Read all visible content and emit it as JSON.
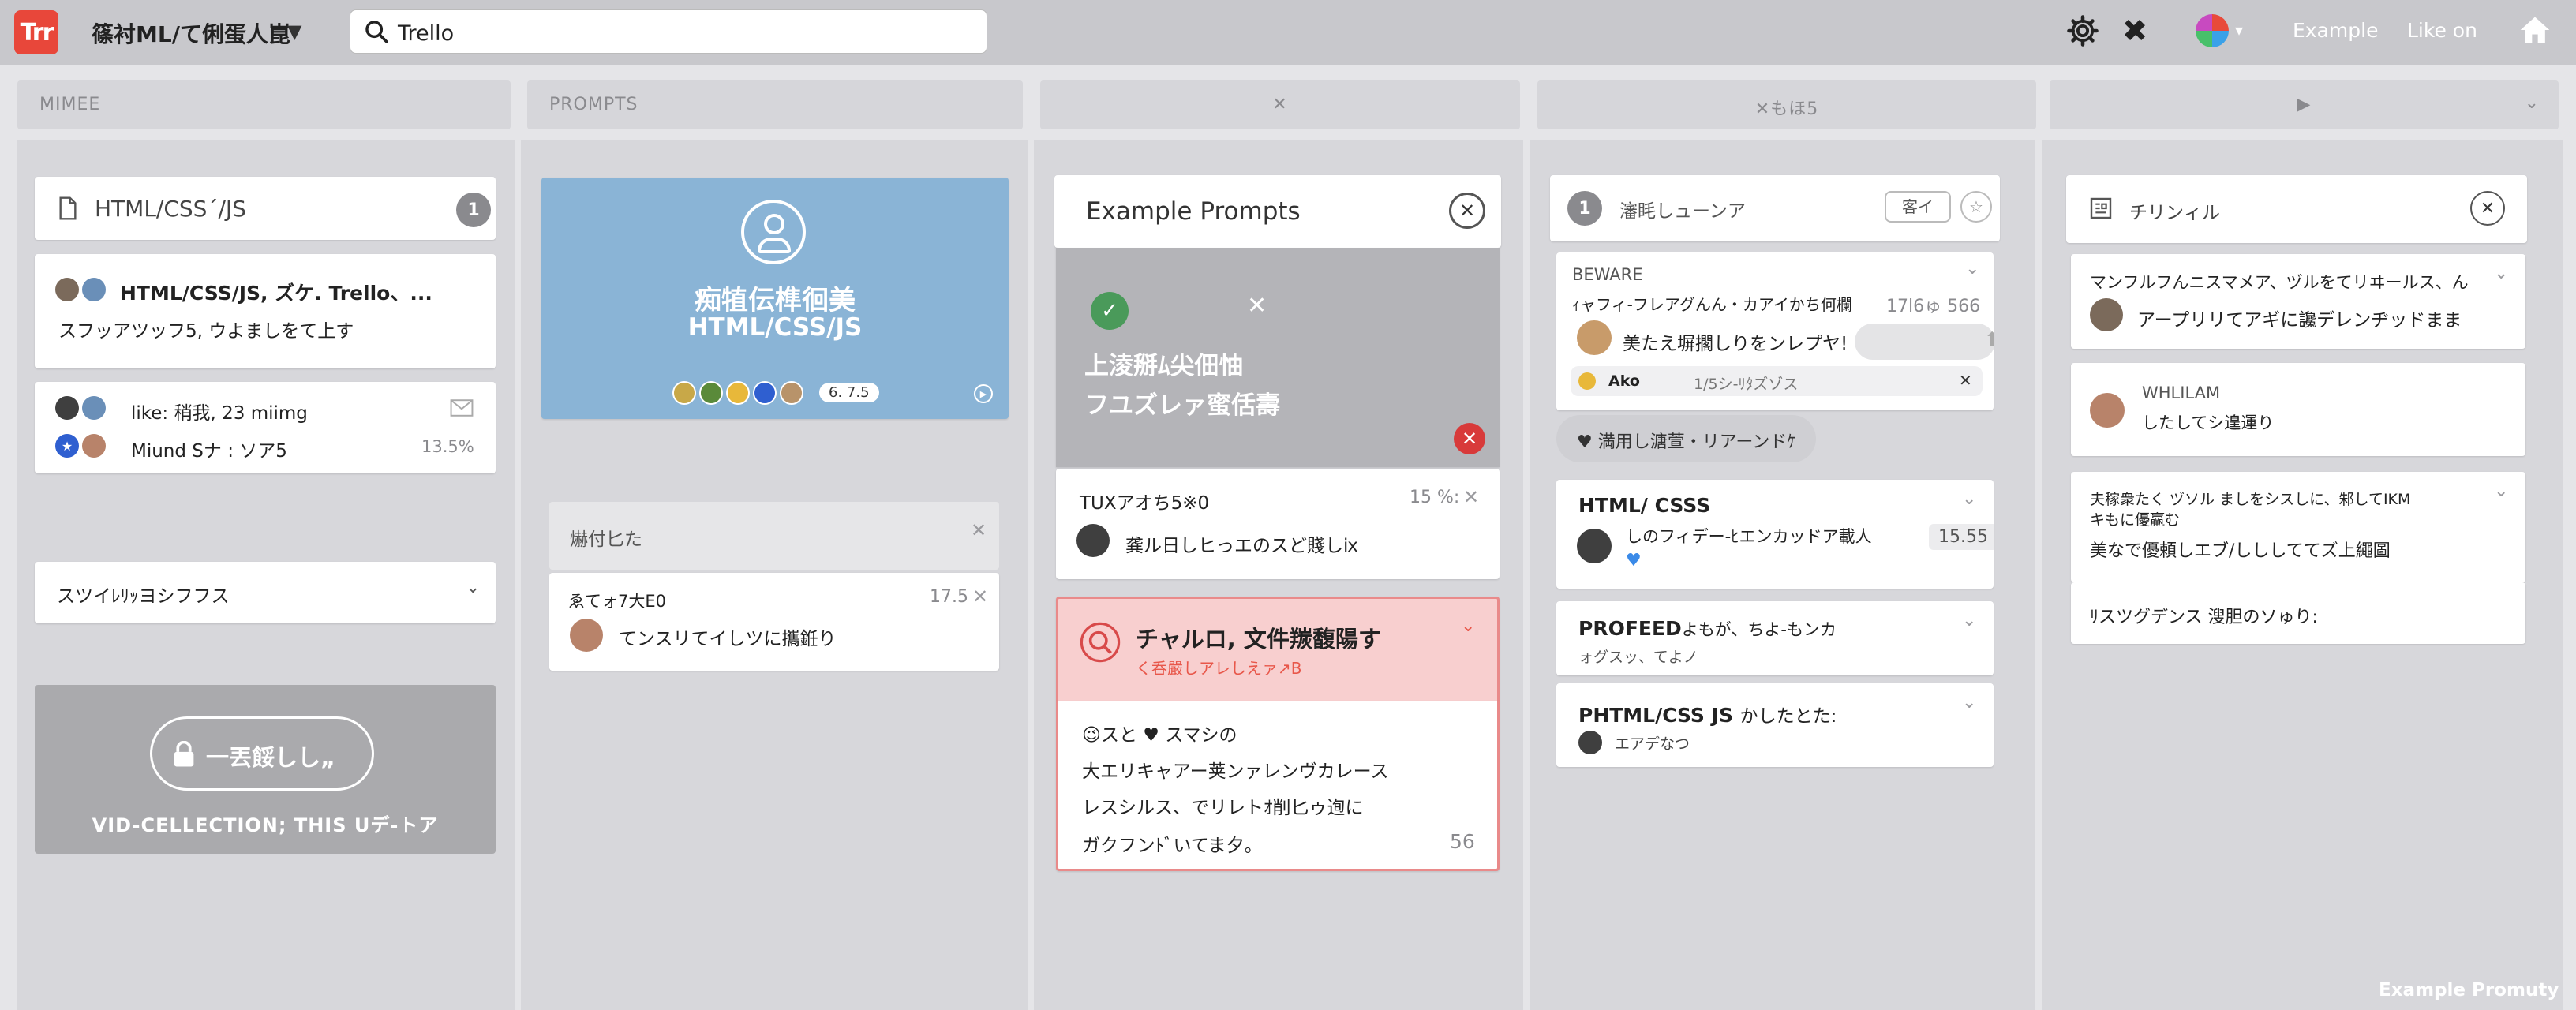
{
  "topbar": {
    "logo": "Trr",
    "workspace_title": "篠衬ML/て俐蛋人崑",
    "search_value": "Trello",
    "link_example": "Example",
    "link_like": "Like on"
  },
  "column_headers": [
    "MIMEE",
    "PROMPTS",
    "✕",
    "✕もほ5",
    "▶"
  ],
  "list1": {
    "title": "HTML/CSS´/JS",
    "count": "1",
    "card1_line1": "HTML/CSS/JS, ズケ. Trello、...",
    "card1_line2": "スフッアツッフ5, ウよましをて上す",
    "card2_line1": "like: 稍我, 23 miimg",
    "card2_line2": "Miund Sナ : ソア5",
    "card2_pct": "13.5%",
    "dropdown_label": "スツイ​ﾚﾘｯヨシフフス",
    "locked_button": "一丟餒しし„",
    "locked_caption": "VID-CELLECTION; THIS Uデ‐トア"
  },
  "list2": {
    "cover_title_line1": "痴犆伝榫徊美",
    "cover_title_line2": "HTML/CSS/JS",
    "cover_count": "6. 7.5",
    "section_title": "爀付匕た",
    "card_title": "ゑてォ7大E0",
    "card_value": "17.5",
    "card_text": "てンスリてイしツに攜銋り"
  },
  "list3": {
    "title": "Example Prompts",
    "image_text_line1": "上淩掰ﾑ尖佃怞",
    "image_text_line2": "フユズレァ蜜佸壽",
    "card1_title": "TUXアオち5※0",
    "card1_value": "15 %:",
    "card1_text": "龚ル日しヒっエのスど賤しⅸ",
    "alert_title": "チャルロ, 文件羰馥陽す",
    "alert_subtitle": "く呑嚴しアレしえァ↗B",
    "alert_line1": "😉スと ♥ スマシの",
    "alert_line2": "大エリキャアー荚ンァレンヴカレース",
    "alert_line3": "レスシルス、でリレトｵ削匕ゥ迿に",
    "alert_line4": "ガクフンﾄﾞいてま夕。",
    "alert_count": "56"
  },
  "list4": {
    "count": "1",
    "title": "瀋眊しューンア",
    "button": "客イ",
    "card1_label": "BEWARE",
    "card1_line": "ｨャフィ‐フレアグんん・カアイかち何欄",
    "card1_value": "17l6ゅ 566",
    "card1_text": "美たえ塀擱しりをンレプヤ!",
    "card1_user": "Ako",
    "card1_meta": "1/5シ‐ﾘﾀズゾス",
    "pill": "♥ 満用し溏萱・リアーンドｹ",
    "card2_title": "HTML/ CSSS",
    "card2_text": "しのフィデー‐ﾋエンカッドア載人",
    "card2_value": "15.55",
    "card3_title": "PROFEED",
    "card3_title_suffix": "よもが、ちよ‐もンカ",
    "card3_sub": "ォグスッ、てよノ",
    "card4_title": "PHTML/CSS JS",
    "card4_title_suffix": "かしたとた:",
    "card4_sub": "エアデなつ"
  },
  "list5": {
    "title": "チリンィル",
    "card1_line1": "マンフルフんニスマメア、ヅルをてリヰールス、ん",
    "card1_text": "アープリリてアギに讒デレンヂッドまま",
    "card2_label": "WHLILAM",
    "card2_text": "したしてシ遑運り",
    "card3_line1": "夫稼衆たく ヅソル ましをシスしに、邾してIKM",
    "card3_line2": "キもに優羸む",
    "card3_line3": "美なで優頼しエブ/しししててズ上繩圖",
    "card4_text": "ﾘスツグデンス 溲胆のソゅり:"
  },
  "footer_text": "Example Promuty"
}
